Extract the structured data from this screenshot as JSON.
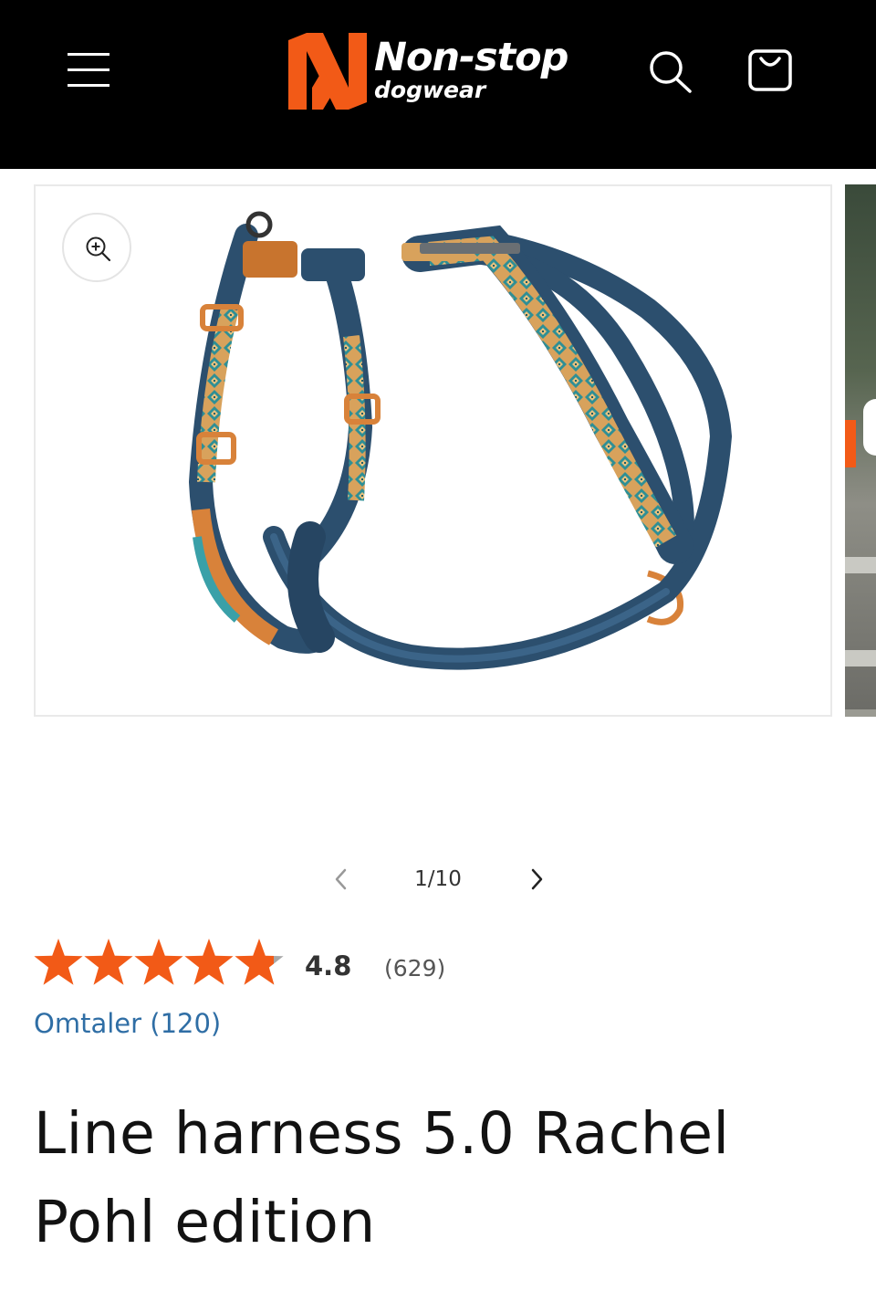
{
  "header": {
    "brand_name": "Non-stop",
    "brand_sub": "dogwear",
    "brand_color": "#f25a17",
    "menu_icon": "hamburger-menu-icon",
    "search_icon": "search-icon",
    "cart_icon": "shopping-bag-icon"
  },
  "gallery": {
    "zoom_icon": "zoom-in-icon",
    "current_slide": 1,
    "total_slides": 10,
    "counter_text": "1/10",
    "prev_icon": "chevron-left-icon",
    "next_icon": "chevron-right-icon"
  },
  "rating": {
    "stars_value": 4.8,
    "stars_max": 5,
    "star_color": "#f25a17",
    "value_text": "4.8",
    "count_text": "(629)",
    "reviews_link": "Omtaler (120)"
  },
  "product": {
    "title": "Line harness 5.0 Rachel Pohl edition"
  }
}
